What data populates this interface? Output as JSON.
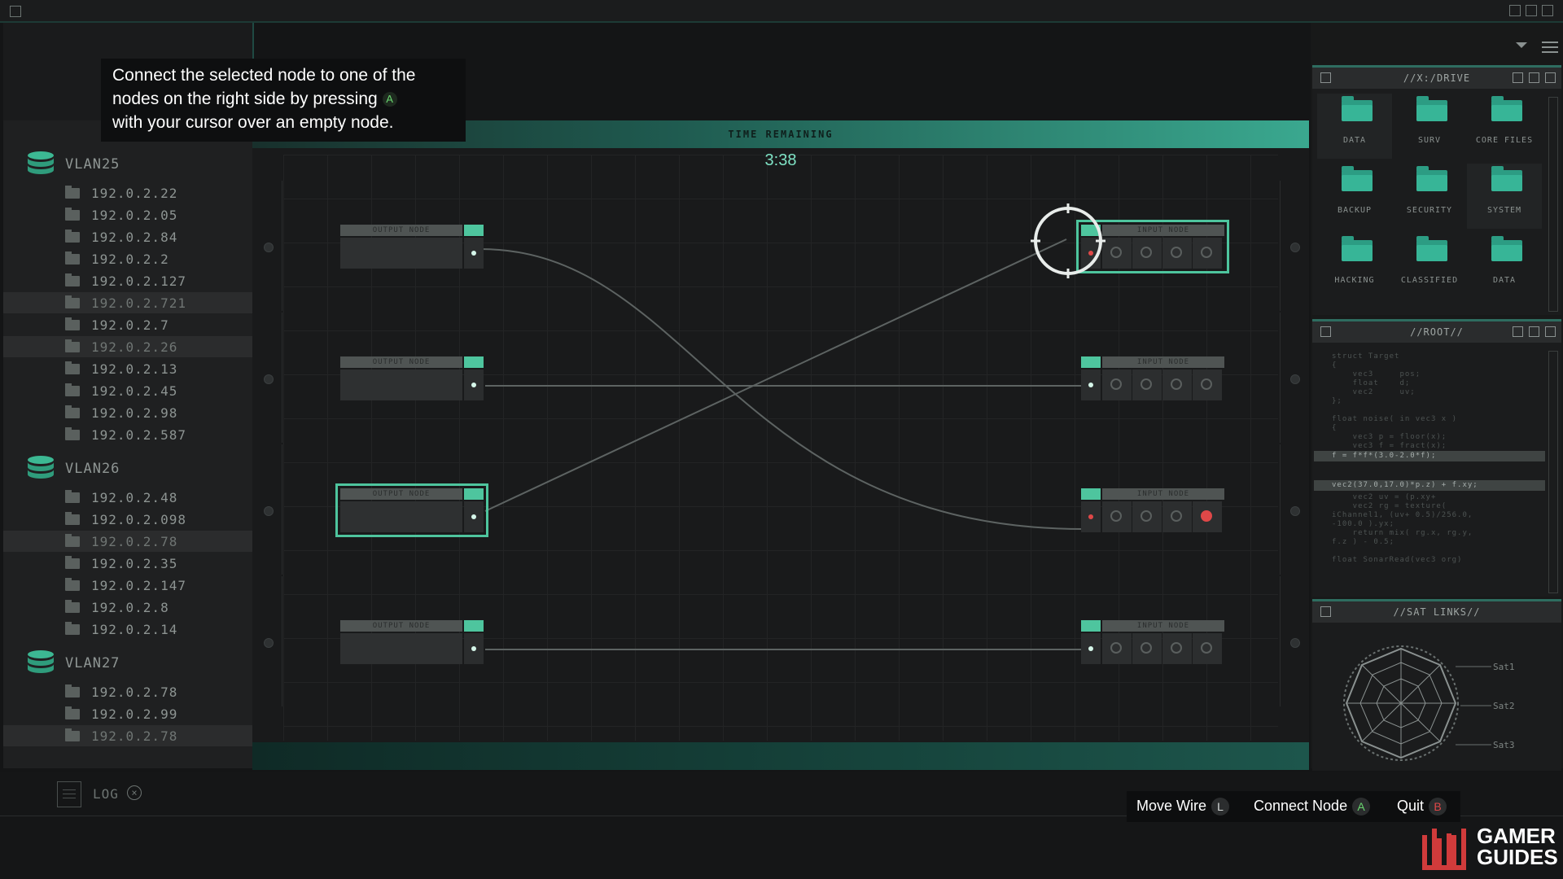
{
  "tooltip": {
    "line1": "Connect the selected node to one of the",
    "line2": "nodes on the right side by pressing",
    "line3": "with your cursor over an empty node.",
    "button": "A"
  },
  "sidebar": {
    "groups": [
      {
        "label": "VLAN25",
        "ips": [
          "192.0.2.22",
          "192.0.2.05",
          "192.0.2.84",
          "192.0.2.2",
          "192.0.2.127",
          "192.0.2.721",
          "192.0.2.7",
          "192.0.2.26",
          "192.0.2.13",
          "192.0.2.45",
          "192.0.2.98",
          "192.0.2.587"
        ]
      },
      {
        "label": "VLAN26",
        "ips": [
          "192.0.2.48",
          "192.0.2.098",
          "192.0.2.78",
          "192.0.2.35",
          "192.0.2.147",
          "192.0.2.8",
          "192.0.2.14"
        ]
      },
      {
        "label": "VLAN27",
        "ips": [
          "192.0.2.78",
          "192.0.2.99",
          "192.0.2.78"
        ]
      }
    ]
  },
  "board": {
    "timer_label": "TIME REMAINING",
    "timer": "3:38",
    "output_label": "OUTPUT NODE",
    "input_label": "INPUT NODE"
  },
  "drive": {
    "title": "//X:/DRIVE",
    "folders": [
      "DATA",
      "SURV",
      "CORE FILES",
      "BACKUP",
      "SECURITY",
      "SYSTEM",
      "HACKING",
      "CLASSIFIED",
      "DATA"
    ]
  },
  "root": {
    "title": "//ROOT//",
    "lines": [
      "struct Target",
      "{",
      "    vec3     pos;",
      "    float    d;",
      "    vec2     uv;",
      "};",
      "",
      "float noise( in vec3 x )",
      "{",
      "    vec3 p = floor(x);",
      "    vec3 f = fract(x);"
    ],
    "highlight1": "f = f*f*(3.0-2.0*f);",
    "highlight2": "vec2(37.0,17.0)*p.z) + f.xy;",
    "lines2": [
      "    vec2 uv = (p.xy+",
      "    vec2 rg = texture(",
      "iChannel1, (uv+ 0.5)/256.0,",
      "-100.0 ).yx;",
      "    return mix( rg.x, rg.y,",
      "f.z ) - 0.5;",
      "",
      "float SonarRead(vec3 org)"
    ]
  },
  "sat": {
    "title": "//SAT LINKS//",
    "links": [
      "Sat1",
      "Sat2",
      "Sat3"
    ]
  },
  "log": {
    "label": "LOG"
  },
  "controls": [
    {
      "label": "Move Wire",
      "key": "L"
    },
    {
      "label": "Connect Node",
      "key": "A"
    },
    {
      "label": "Quit",
      "key": "B"
    }
  ],
  "logo": {
    "line1": "GAMER",
    "line2": "GUIDES"
  },
  "colors": {
    "accent": "#4ec59e",
    "alert": "#e04848",
    "button_a": "#69d66f",
    "button_b": "#e04848"
  }
}
